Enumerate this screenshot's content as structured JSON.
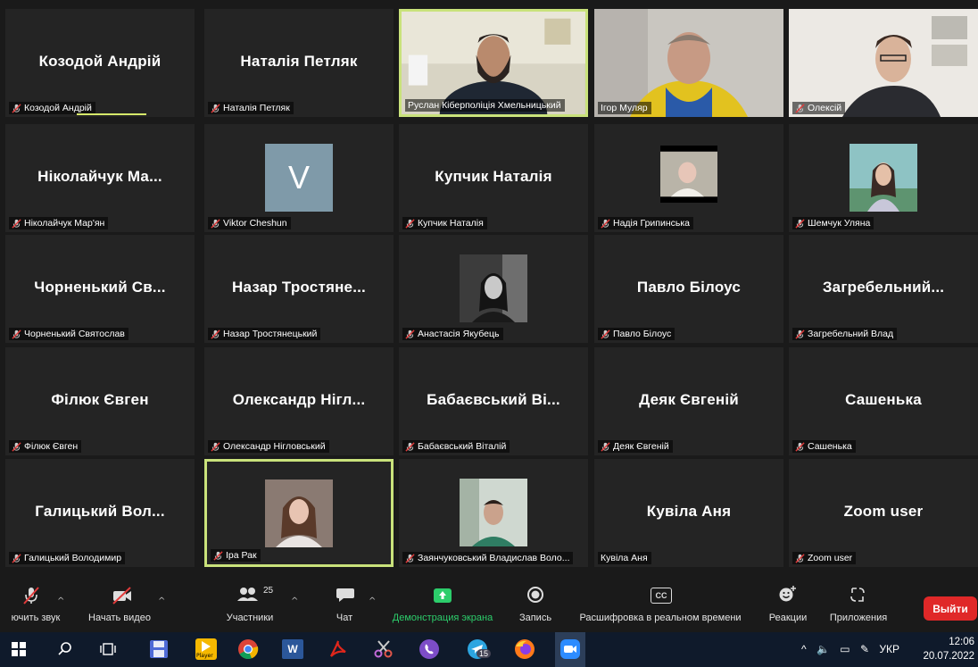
{
  "tiles": [
    {
      "big": "Козодой Андрій",
      "label": "Козодой Андрій"
    },
    {
      "big": "Наталія Петляк",
      "label": "Наталія Петляк"
    },
    {
      "big": "",
      "label": "Руслан Кіберполіція Хмельницький"
    },
    {
      "big": "",
      "label": "Ігор Муляр"
    },
    {
      "big": "",
      "label": "Олексій"
    },
    {
      "big": "Ніколайчук Ма...",
      "label": "Ніколайчук Мар'ян"
    },
    {
      "big": "",
      "label": "Viktor Cheshun",
      "avatar_letter": "V"
    },
    {
      "big": "Купчик Наталія",
      "label": "Купчик Наталія"
    },
    {
      "big": "",
      "label": "Надія Грипинська"
    },
    {
      "big": "",
      "label": "Шемчук Уляна"
    },
    {
      "big": "Чорненький Св...",
      "label": "Чорненький Святослав"
    },
    {
      "big": "Назар Тростяне...",
      "label": "Назар Тростянецький"
    },
    {
      "big": "",
      "label": "Анастасія Якубець"
    },
    {
      "big": "Павло Білоус",
      "label": "Павло Білоус"
    },
    {
      "big": "Загребельний...",
      "label": "Загребельний Влад"
    },
    {
      "big": "Філюк Євген",
      "label": "Філюк Євген"
    },
    {
      "big": "Олександр Нігл...",
      "label": "Олександр Нігловський"
    },
    {
      "big": "Бабаєвський Ві...",
      "label": "Бабаєвський Віталій"
    },
    {
      "big": "Деяк Євгеній",
      "label": "Деяк Євгеній"
    },
    {
      "big": "Сашенька",
      "label": "Сашенька"
    },
    {
      "big": "Галицький Вол...",
      "label": "Галицький Володимир"
    },
    {
      "big": "",
      "label": "Іра Рак"
    },
    {
      "big": "",
      "label": "Заянчуковський Владислав Воло..."
    },
    {
      "big": "Кувіла Аня",
      "label": "Кувіла Аня"
    },
    {
      "big": "Zoom user",
      "label": "Zoom user"
    }
  ],
  "toolbar": {
    "audio_label": "ючить звук",
    "video_label": "Начать видео",
    "participants_label": "Участники",
    "participants_count": "25",
    "chat_label": "Чат",
    "share_label": "Демонстрация экрана",
    "record_label": "Запись",
    "cc_label": "Расшифровка в реальном времени",
    "cc_icon_text": "CC",
    "reactions_label": "Реакции",
    "apps_label": "Приложения",
    "leave_label": "Выйти"
  },
  "taskbar": {
    "lang": "УКР",
    "time": "12:06",
    "date": "20.07.2022",
    "telegram_badge": "15",
    "word_letter": "W",
    "player_label": "Player"
  },
  "colors": {
    "active_border": "#c9e27b",
    "share_green": "#2ccd6b",
    "leave_red": "#e02828",
    "muted_red": "#e23b3b"
  }
}
